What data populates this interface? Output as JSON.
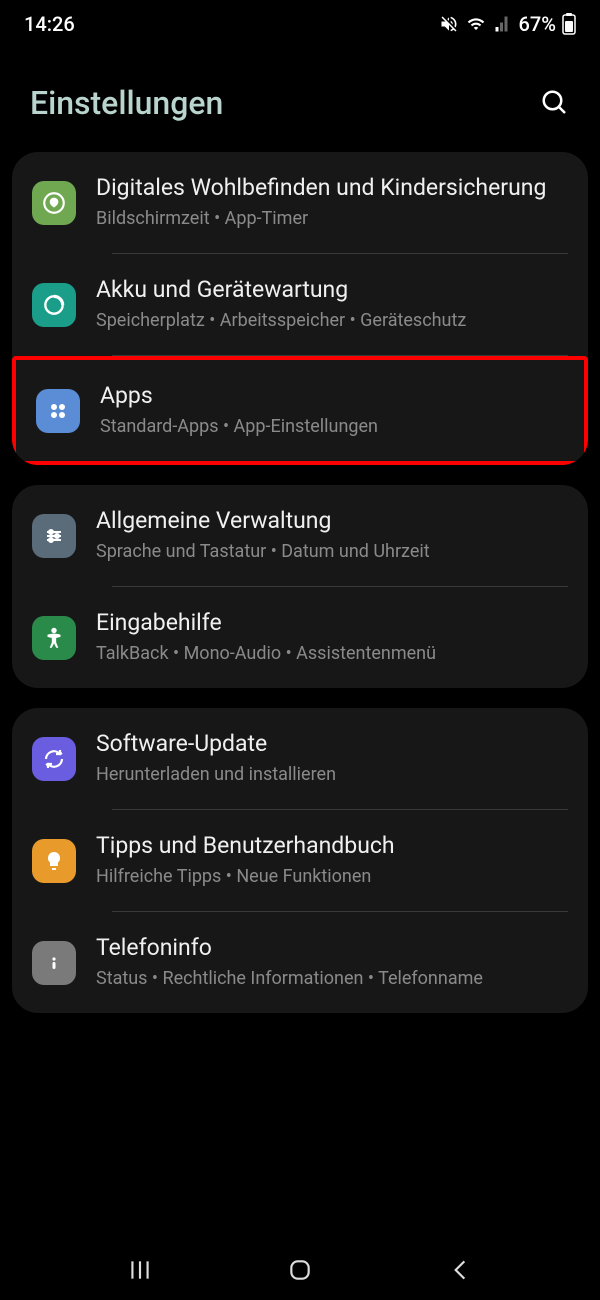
{
  "status": {
    "time": "14:26",
    "battery": "67%"
  },
  "header": {
    "title": "Einstellungen"
  },
  "groups": [
    {
      "items": [
        {
          "title": "Digitales Wohlbefinden und Kindersicherung",
          "subtitle": "Bildschirmzeit  •  App-Timer"
        },
        {
          "title": "Akku und Gerätewartung",
          "subtitle": "Speicherplatz  •  Arbeitsspeicher  •  Geräteschutz"
        },
        {
          "title": "Apps",
          "subtitle": "Standard-Apps  •  App-Einstellungen"
        }
      ]
    },
    {
      "items": [
        {
          "title": "Allgemeine Verwaltung",
          "subtitle": "Sprache und Tastatur  •  Datum und Uhrzeit"
        },
        {
          "title": "Eingabehilfe",
          "subtitle": "TalkBack  •  Mono-Audio  •  Assistentenmenü"
        }
      ]
    },
    {
      "items": [
        {
          "title": "Software-Update",
          "subtitle": "Herunterladen und installieren"
        },
        {
          "title": "Tipps und Benutzerhandbuch",
          "subtitle": "Hilfreiche Tipps  •  Neue Funktionen"
        },
        {
          "title": "Telefoninfo",
          "subtitle": "Status  •  Rechtliche Informationen  •  Telefonname"
        }
      ]
    }
  ]
}
